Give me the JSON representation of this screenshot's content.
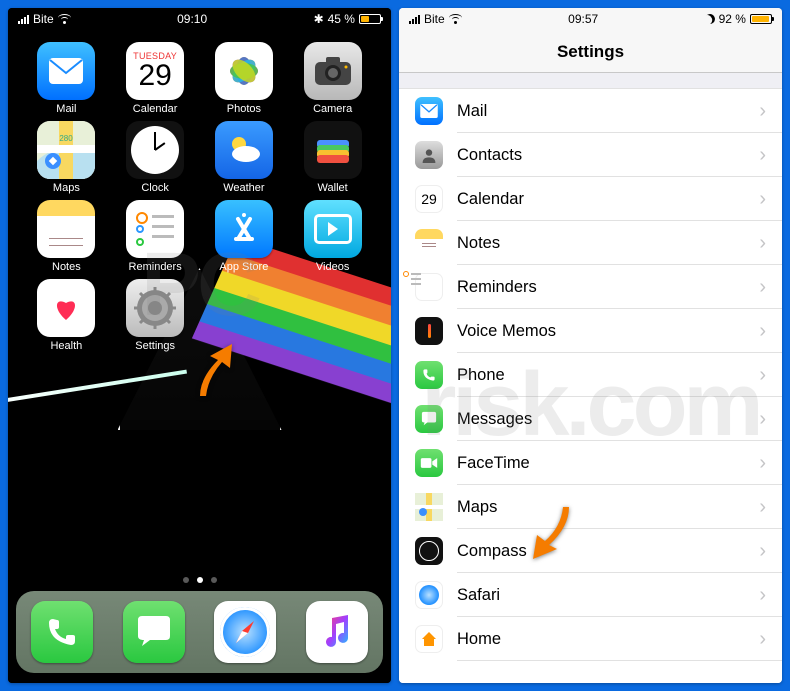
{
  "watermark_top": "PC",
  "watermark_bottom": "risk.com",
  "arrow_color": "#f57c00",
  "left": {
    "status": {
      "carrier": "Bite",
      "time": "09:10",
      "battery_symbol": "✱",
      "battery_pct": "45 %"
    },
    "calendar": {
      "day": "TUESDAY",
      "date": "29"
    },
    "apps_row1": [
      "Mail",
      "Calendar",
      "Photos",
      "Camera"
    ],
    "apps_row2": [
      "Maps",
      "Clock",
      "Weather",
      "Wallet"
    ],
    "apps_row3": [
      "Notes",
      "Reminders",
      "App Store",
      "Videos"
    ],
    "apps_row4": [
      "Health",
      "Settings"
    ],
    "page_dots": 3,
    "active_dot": 1
  },
  "right": {
    "status": {
      "carrier": "Bite",
      "time": "09:57",
      "battery_pct": "92 %"
    },
    "title": "Settings",
    "items": [
      {
        "label": "Mail",
        "icon": "mail"
      },
      {
        "label": "Contacts",
        "icon": "contacts"
      },
      {
        "label": "Calendar",
        "icon": "calendar"
      },
      {
        "label": "Notes",
        "icon": "notes"
      },
      {
        "label": "Reminders",
        "icon": "reminders"
      },
      {
        "label": "Voice Memos",
        "icon": "voice"
      },
      {
        "label": "Phone",
        "icon": "phone"
      },
      {
        "label": "Messages",
        "icon": "msg"
      },
      {
        "label": "FaceTime",
        "icon": "facetime"
      },
      {
        "label": "Maps",
        "icon": "maps"
      },
      {
        "label": "Compass",
        "icon": "compass"
      },
      {
        "label": "Safari",
        "icon": "safari"
      },
      {
        "label": "Home",
        "icon": "home"
      }
    ],
    "calendar": {
      "date": "29"
    }
  }
}
